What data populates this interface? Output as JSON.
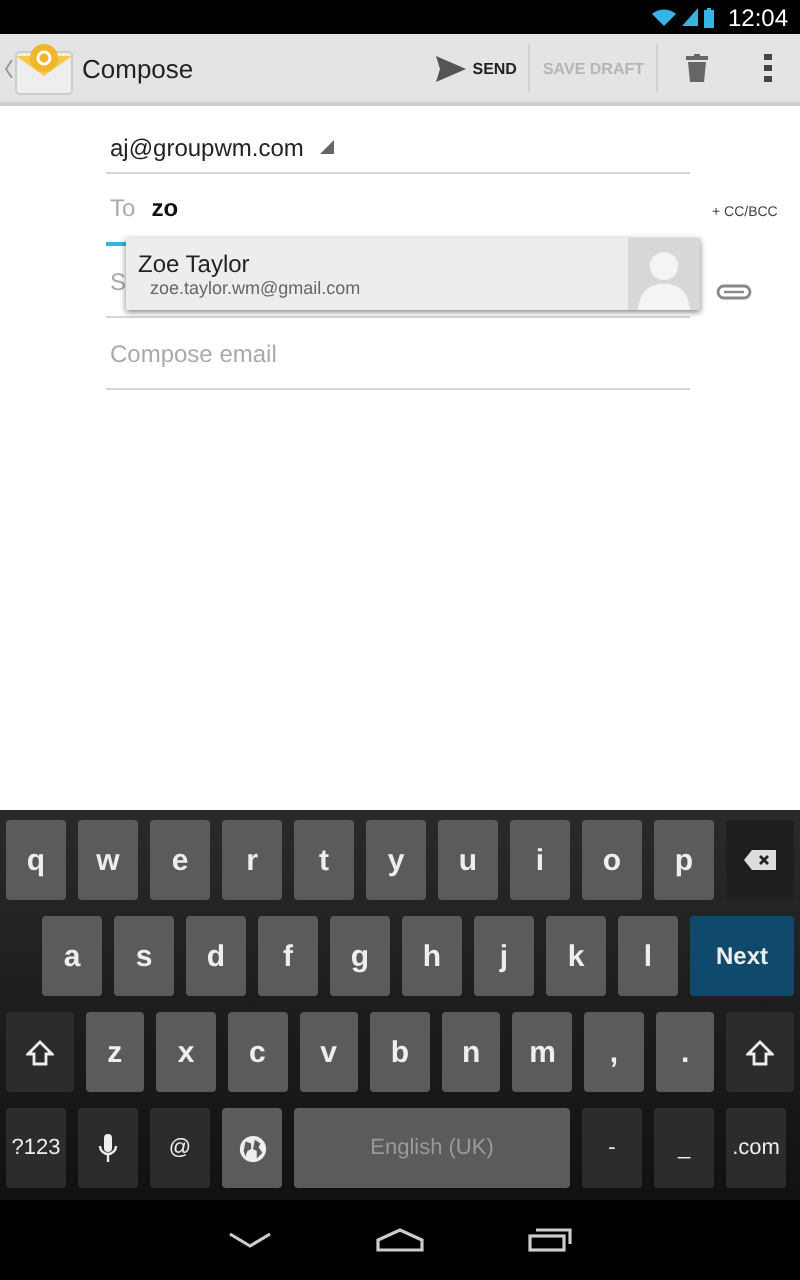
{
  "status_bar": {
    "time": "12:04"
  },
  "action_bar": {
    "title": "Compose",
    "actions": [
      {
        "label": "SEND",
        "kind": "send",
        "disabled": false
      },
      {
        "label": "SAVE DRAFT",
        "kind": "text",
        "disabled": true
      },
      {
        "kind": "delete"
      },
      {
        "kind": "overflow"
      }
    ]
  },
  "form": {
    "from": "aj@groupwm.com",
    "to": {
      "label": "To",
      "value": "zo",
      "focused": true
    },
    "cc_bcc": "+ CC/BCC",
    "subject": {
      "placeholder": "S"
    },
    "body": {
      "placeholder": "Compose email"
    }
  },
  "suggestions": [
    {
      "name": "Zoe Taylor",
      "email": "zoe.taylor.wm@gmail.com"
    }
  ],
  "keyboard": {
    "rows": [
      {
        "keys": [
          {
            "label": "q",
            "kind": "letter"
          },
          {
            "label": "w",
            "kind": "letter"
          },
          {
            "label": "e",
            "kind": "letter"
          },
          {
            "label": "r",
            "kind": "letter"
          },
          {
            "label": "t",
            "kind": "letter"
          },
          {
            "label": "y",
            "kind": "letter"
          },
          {
            "label": "u",
            "kind": "letter"
          },
          {
            "label": "i",
            "kind": "letter"
          },
          {
            "label": "o",
            "kind": "letter"
          },
          {
            "label": "p",
            "kind": "letter"
          },
          {
            "kind": "backspace"
          }
        ]
      },
      {
        "keys": [
          {
            "label": "a",
            "kind": "letter"
          },
          {
            "label": "s",
            "kind": "letter"
          },
          {
            "label": "d",
            "kind": "letter"
          },
          {
            "label": "f",
            "kind": "letter"
          },
          {
            "label": "g",
            "kind": "letter"
          },
          {
            "label": "h",
            "kind": "letter"
          },
          {
            "label": "j",
            "kind": "letter"
          },
          {
            "label": "k",
            "kind": "letter"
          },
          {
            "label": "l",
            "kind": "letter"
          },
          {
            "label": "Next",
            "kind": "action"
          }
        ]
      },
      {
        "keys": [
          {
            "kind": "shift"
          },
          {
            "label": "z",
            "kind": "letter"
          },
          {
            "label": "x",
            "kind": "letter"
          },
          {
            "label": "c",
            "kind": "letter"
          },
          {
            "label": "v",
            "kind": "letter"
          },
          {
            "label": "b",
            "kind": "letter"
          },
          {
            "label": "n",
            "kind": "letter"
          },
          {
            "label": "m",
            "kind": "letter"
          },
          {
            "label": ",",
            "kind": "letter"
          },
          {
            "label": ".",
            "kind": "letter"
          },
          {
            "kind": "shift"
          }
        ]
      },
      {
        "keys": [
          {
            "label": "?123",
            "kind": "function"
          },
          {
            "kind": "mic"
          },
          {
            "label": "@",
            "kind": "function"
          },
          {
            "kind": "globe"
          },
          {
            "label": "English (UK)",
            "kind": "space"
          },
          {
            "label": "-",
            "kind": "function"
          },
          {
            "label": "_",
            "kind": "function"
          },
          {
            "label": ".com",
            "kind": "function"
          }
        ]
      }
    ]
  }
}
